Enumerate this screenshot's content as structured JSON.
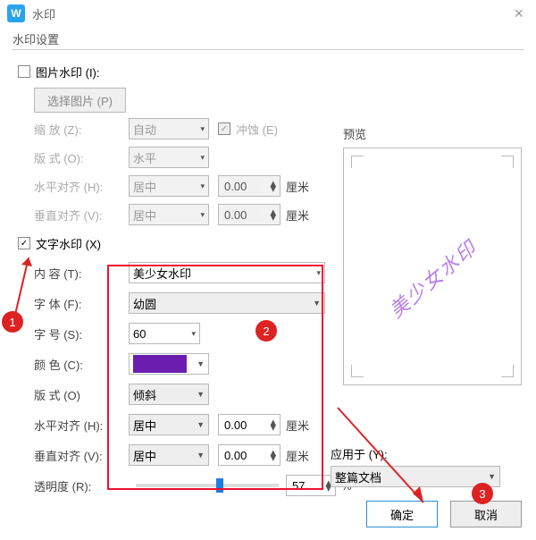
{
  "window": {
    "title": "水印",
    "close": "×",
    "logo": "W"
  },
  "group": {
    "label": "水印设置"
  },
  "picture": {
    "checkbox_label": "图片水印 (I):",
    "choose_btn": "选择图片 (P)",
    "zoom_label": "缩  放 (Z):",
    "zoom_value": "自动",
    "erode_label": "冲蚀 (E)",
    "layout_label": "版  式 (O):",
    "layout_value": "水平",
    "halign_label": "水平对齐 (H):",
    "halign_value": "居中",
    "halign_spin": "0.00",
    "halign_unit": "厘米",
    "valign_label": "垂直对齐 (V):",
    "valign_value": "居中",
    "valign_spin": "0.00",
    "valign_unit": "厘米"
  },
  "text": {
    "checkbox_label": "文字水印 (X)",
    "content_label": "内  容 (T):",
    "content_value": "美少女水印",
    "font_label": "字  体 (F):",
    "font_value": "幼圆",
    "size_label": "字  号 (S):",
    "size_value": "60",
    "color_label": "颜  色 (C):",
    "layout_label": "版  式 (O)",
    "layout_value": "倾斜",
    "halign_label": "水平对齐 (H):",
    "halign_value": "居中",
    "halign_spin": "0.00",
    "halign_unit": "厘米",
    "valign_label": "垂直对齐 (V):",
    "valign_value": "居中",
    "valign_spin": "0.00",
    "valign_unit": "厘米",
    "opacity_label": "透明度 (R):",
    "opacity_value": "57",
    "opacity_unit": "%"
  },
  "preview": {
    "label": "预览",
    "watermark": "美少女水印"
  },
  "apply": {
    "label": "应用于 (Y):",
    "value": "整篇文档"
  },
  "footer": {
    "ok": "确定",
    "cancel": "取消"
  },
  "callouts": {
    "c1": "1",
    "c2": "2",
    "c3": "3"
  },
  "colors": {
    "swatch": "#6b1db0"
  }
}
